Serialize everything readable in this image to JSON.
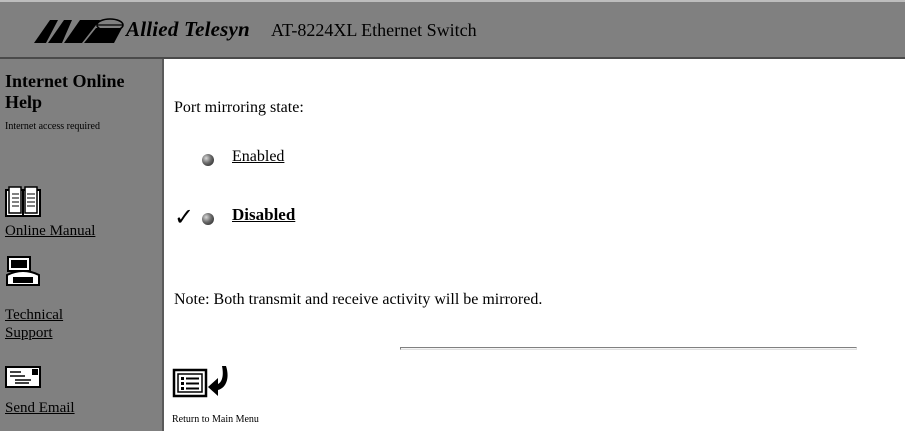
{
  "header": {
    "brand": "Allied Telesyn",
    "product": "AT-8224XL Ethernet Switch",
    "logo_icon": "allied-telesyn-logo-icon"
  },
  "sidebar": {
    "help_title": "Internet Online Help",
    "help_note": "Internet access required",
    "links": [
      {
        "label": "Online Manual",
        "icon": "book-icon"
      },
      {
        "label": "Technical Support",
        "icon": "telephone-icon"
      },
      {
        "label": "Send Email",
        "icon": "envelope-icon"
      }
    ]
  },
  "main": {
    "prompt": "Port mirroring state:",
    "options": [
      {
        "label": "Enabled",
        "selected": false
      },
      {
        "label": "Disabled",
        "selected": true
      }
    ],
    "selected_mark": "✓",
    "note": "Note: Both transmit and receive activity will be mirrored.",
    "return_label": "Return to Main Menu"
  },
  "colors": {
    "header_bg": "#808080",
    "sidebar_bg": "#808080",
    "content_bg": "#ffffff"
  }
}
